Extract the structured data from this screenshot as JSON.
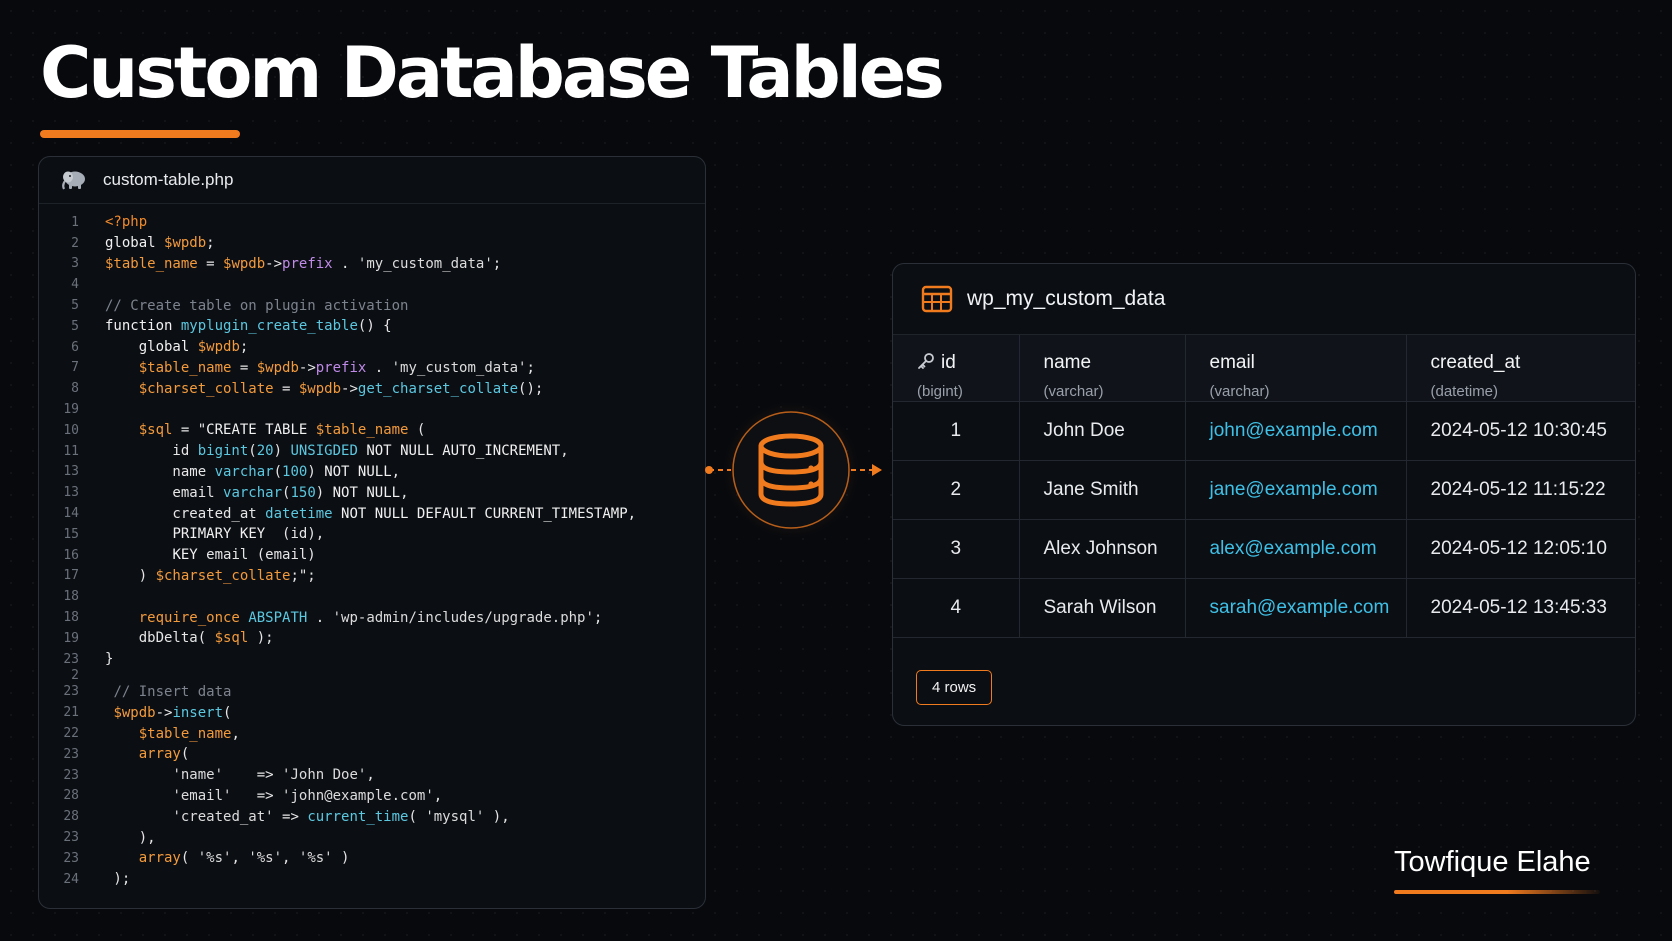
{
  "page": {
    "title": "Custom Database Tables",
    "author": "Towfique Elahe",
    "accent_color": "#f07a1e"
  },
  "code": {
    "filename": "custom-table.php",
    "icon": "php-elephant-icon",
    "lines": [
      {
        "n": "1",
        "text": "<?php"
      },
      {
        "n": "2",
        "text": "global $wpdb;"
      },
      {
        "n": "3",
        "text": "$table_name = $wpdb->prefix . 'my_custom_data';"
      },
      {
        "n": "4",
        "text": ""
      },
      {
        "n": "5",
        "text": "// Create table on plugin activation"
      },
      {
        "n": "5",
        "text": "function myplugin_create_table() {"
      },
      {
        "n": "6",
        "text": "    global $wpdb;"
      },
      {
        "n": "7",
        "text": "    $table_name = $wpdb->prefix . 'my_custom_data';"
      },
      {
        "n": "8",
        "text": "    $charset_collate = $wpdb->get_charset_collate();"
      },
      {
        "n": "19",
        "text": ""
      },
      {
        "n": "10",
        "text": "    $sql = \"CREATE TABLE $table_name ("
      },
      {
        "n": "11",
        "text": "        id bigint(20) UNSIGDED NOT NULL AUTO_INCREMENT,"
      },
      {
        "n": "13",
        "text": "        name varchar(100) NOT NULL,"
      },
      {
        "n": "13",
        "text": "        email varchar(150) NOT NULL,"
      },
      {
        "n": "14",
        "text": "        created_at datetime NOT NULL DEFAULT CURRENT_TIMESTAMP,"
      },
      {
        "n": "15",
        "text": "        PRIMARY KEY  (id),"
      },
      {
        "n": "16",
        "text": "        KEY email (email)"
      },
      {
        "n": "17",
        "text": "    ) $charset_collate;\";"
      },
      {
        "n": "18",
        "text": ""
      },
      {
        "n": "18",
        "text": "    require_once ABSPATH . 'wp-admin/includes/upgrade.php';"
      },
      {
        "n": "19",
        "text": "    dbDelta( $sql );"
      },
      {
        "n": "23",
        "text": "}"
      },
      {
        "n": "2",
        "text": ""
      },
      {
        "n": "23",
        "text": " // Insert data"
      },
      {
        "n": "21",
        "text": " $wpdb->insert("
      },
      {
        "n": "22",
        "text": "    $table_name,"
      },
      {
        "n": "23",
        "text": "    array("
      },
      {
        "n": "23",
        "text": "        'name'    => 'John Doe',"
      },
      {
        "n": "28",
        "text": "        'email'   => 'john@example.com',"
      },
      {
        "n": "28",
        "text": "        'created_at' => current_time( 'mysql' ),"
      },
      {
        "n": "23",
        "text": "    ),"
      },
      {
        "n": "23",
        "text": "    array( '%s', '%s', '%s' )"
      },
      {
        "n": "24",
        "text": " );"
      }
    ]
  },
  "connector": {
    "icon": "database-icon"
  },
  "table": {
    "name": "wp_my_custom_data",
    "icon": "table-grid-icon",
    "columns": [
      {
        "name": "id",
        "type": "(bigint)",
        "icon": "key-icon"
      },
      {
        "name": "name",
        "type": "(varchar)"
      },
      {
        "name": "email",
        "type": "(varchar)"
      },
      {
        "name": "created_at",
        "type": "(datetime)"
      }
    ],
    "rows": [
      [
        "1",
        "John Doe",
        "john@example.com",
        "2024-05-12 10:30:45"
      ],
      [
        "2",
        "Jane Smith",
        "jane@example.com",
        "2024-05-12 11:15:22"
      ],
      [
        "3",
        "Alex Johnson",
        "alex@example.com",
        "2024-05-12 12:05:10"
      ],
      [
        "4",
        "Sarah Wilson",
        "sarah@example.com",
        "2024-05-12 13:45:33"
      ]
    ],
    "row_count_label": "4 rows"
  }
}
